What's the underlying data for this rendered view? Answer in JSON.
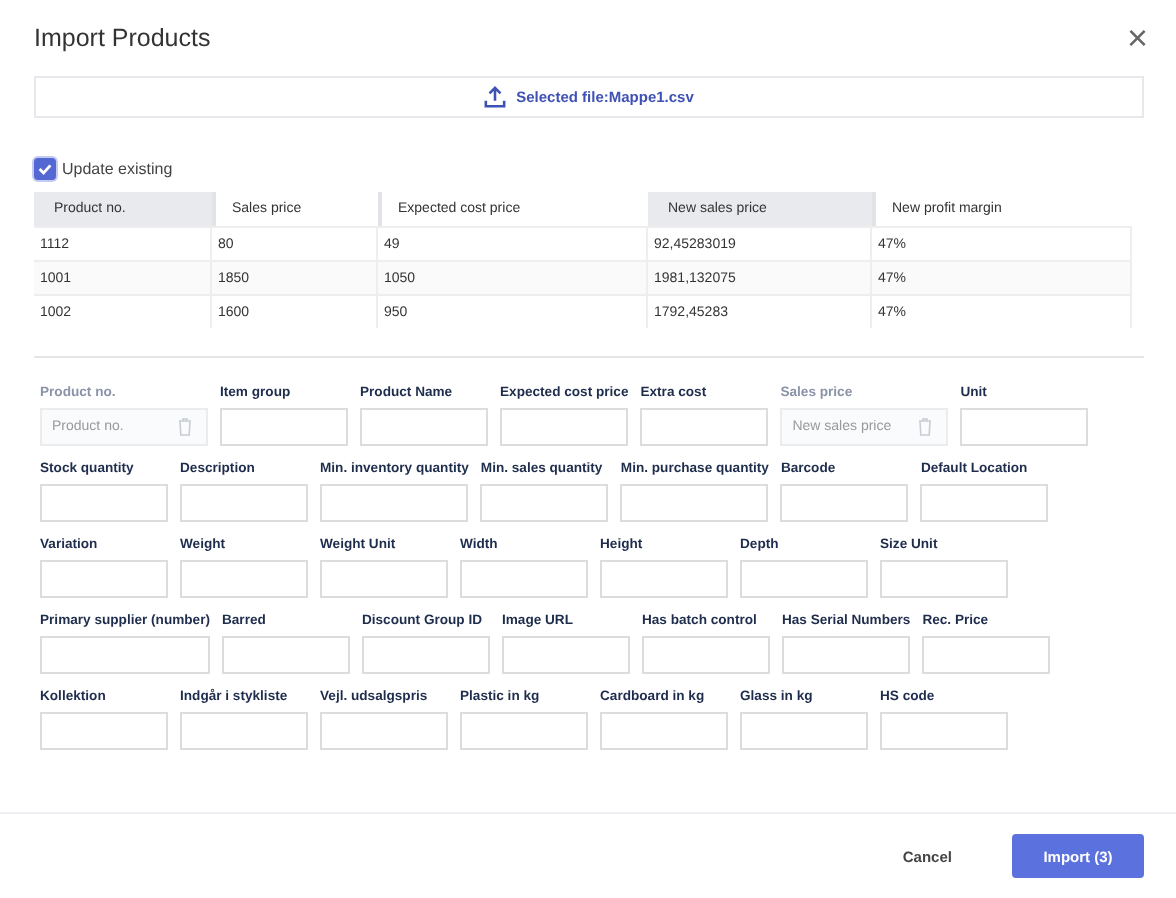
{
  "dialog": {
    "title": "Import Products",
    "close": "×"
  },
  "file": {
    "label": "Selected file:Mappe1.csv"
  },
  "update_existing": {
    "label": "Update existing",
    "checked": true
  },
  "table": {
    "columns": [
      {
        "label": "Product no.",
        "highlighted": true
      },
      {
        "label": "Sales price",
        "highlighted": false
      },
      {
        "label": "Expected cost price",
        "highlighted": false
      },
      {
        "label": "New sales price",
        "highlighted": true
      },
      {
        "label": "New profit margin",
        "highlighted": false
      }
    ],
    "rows": [
      [
        "1112",
        "80",
        "49",
        "92,45283019",
        "47%"
      ],
      [
        "1001",
        "1850",
        "1050",
        "1981,132075",
        "47%"
      ],
      [
        "1002",
        "1600",
        "950",
        "1792,45283",
        "47%"
      ]
    ]
  },
  "field_rows": [
    [
      {
        "label": "Product no.",
        "disabled": true,
        "placeholder": "Product no."
      },
      {
        "label": "Item group",
        "disabled": false
      },
      {
        "label": "Product Name",
        "disabled": false
      },
      {
        "label": "Expected cost price",
        "disabled": false
      },
      {
        "label": "Extra cost",
        "disabled": false
      },
      {
        "label": "Sales price",
        "disabled": true,
        "placeholder": "New sales price"
      },
      {
        "label": "Unit",
        "disabled": false
      }
    ],
    [
      {
        "label": "Stock quantity",
        "disabled": false
      },
      {
        "label": "Description",
        "disabled": false
      },
      {
        "label": "Min. inventory quantity",
        "disabled": false
      },
      {
        "label": "Min. sales quantity",
        "disabled": false
      },
      {
        "label": "Min. purchase quantity",
        "disabled": false
      },
      {
        "label": "Barcode",
        "disabled": false
      },
      {
        "label": "Default Location",
        "disabled": false
      }
    ],
    [
      {
        "label": "Variation",
        "disabled": false
      },
      {
        "label": "Weight",
        "disabled": false
      },
      {
        "label": "Weight Unit",
        "disabled": false
      },
      {
        "label": "Width",
        "disabled": false
      },
      {
        "label": "Height",
        "disabled": false
      },
      {
        "label": "Depth",
        "disabled": false
      },
      {
        "label": "Size Unit",
        "disabled": false
      }
    ],
    [
      {
        "label": "Primary supplier (number)",
        "disabled": false
      },
      {
        "label": "Barred",
        "disabled": false
      },
      {
        "label": "Discount Group ID",
        "disabled": false
      },
      {
        "label": "Image URL",
        "disabled": false
      },
      {
        "label": "Has batch control",
        "disabled": false
      },
      {
        "label": "Has Serial Numbers",
        "disabled": false
      },
      {
        "label": "Rec. Price",
        "disabled": false
      }
    ],
    [
      {
        "label": "Kollektion",
        "disabled": false
      },
      {
        "label": "Indgår i stykliste",
        "disabled": false
      },
      {
        "label": "Vejl. udsalgspris",
        "disabled": false
      },
      {
        "label": "Plastic in kg",
        "disabled": false
      },
      {
        "label": "Cardboard in kg",
        "disabled": false
      },
      {
        "label": "Glass in kg",
        "disabled": false
      },
      {
        "label": "HS code",
        "disabled": false
      }
    ]
  ],
  "buttons": {
    "cancel": "Cancel",
    "import": "Import (3)"
  }
}
